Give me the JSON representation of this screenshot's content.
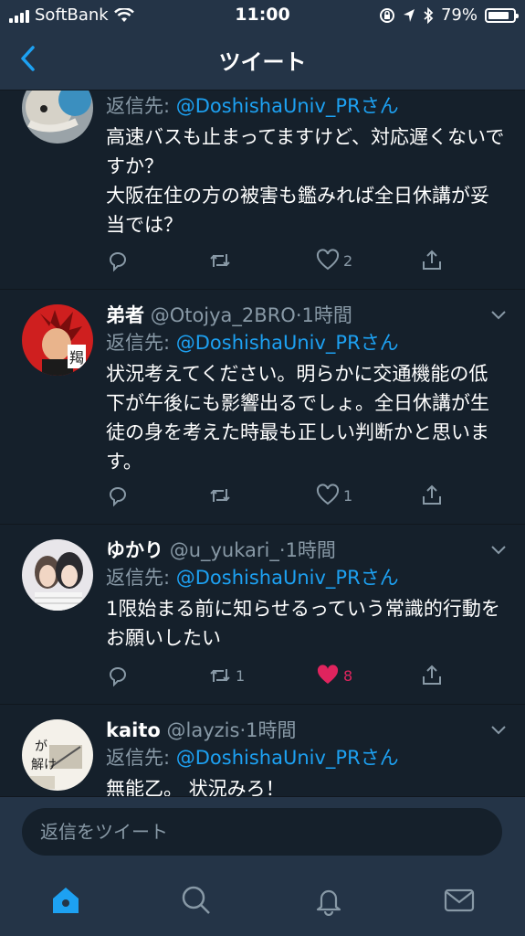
{
  "status_bar": {
    "carrier": "SoftBank",
    "time": "11:00",
    "battery": "79%"
  },
  "nav": {
    "title": "ツイート"
  },
  "reply_prefix": "返信先: ",
  "reply_suffix": "さん",
  "tweets": [
    {
      "reply_to": "@DoshishaUniv_PR",
      "text": "高速バスも止まってますけど、対応遅くないですか？\n大阪在住の方の被害も鑑みれば全日休講が妥当では？",
      "retweet_count": "",
      "like_count": "2",
      "liked": false
    },
    {
      "name": "弟者",
      "handle": "@Otojya_2BRO",
      "time": "1時間",
      "reply_to": "@DoshishaUniv_PR",
      "text": "状況考えてください。明らかに交通機能の低下が午後にも影響出るでしょ。全日休講が生徒の身を考えた時最も正しい判断かと思います。",
      "retweet_count": "",
      "like_count": "1",
      "liked": false
    },
    {
      "name": "ゆかり",
      "handle": "@u_yukari_",
      "time": "1時間",
      "reply_to": "@DoshishaUniv_PR",
      "text": "1限始まる前に知らせるっていう常識的行動をお願いしたい",
      "retweet_count": "1",
      "like_count": "8",
      "liked": true
    },
    {
      "name": "kaito",
      "handle": "@layzis",
      "time": "1時間",
      "reply_to": "@DoshishaUniv_PR",
      "text": "無能乙。 状況みろ！"
    }
  ],
  "reply_bar": {
    "placeholder": "返信をツイート"
  },
  "tabs": [
    "home",
    "search",
    "notifications",
    "messages"
  ],
  "colors": {
    "background": "#15202b",
    "bar": "#243447",
    "accent": "#1da1f2",
    "like": "#e0245e",
    "secondary_text": "#8899a6"
  }
}
